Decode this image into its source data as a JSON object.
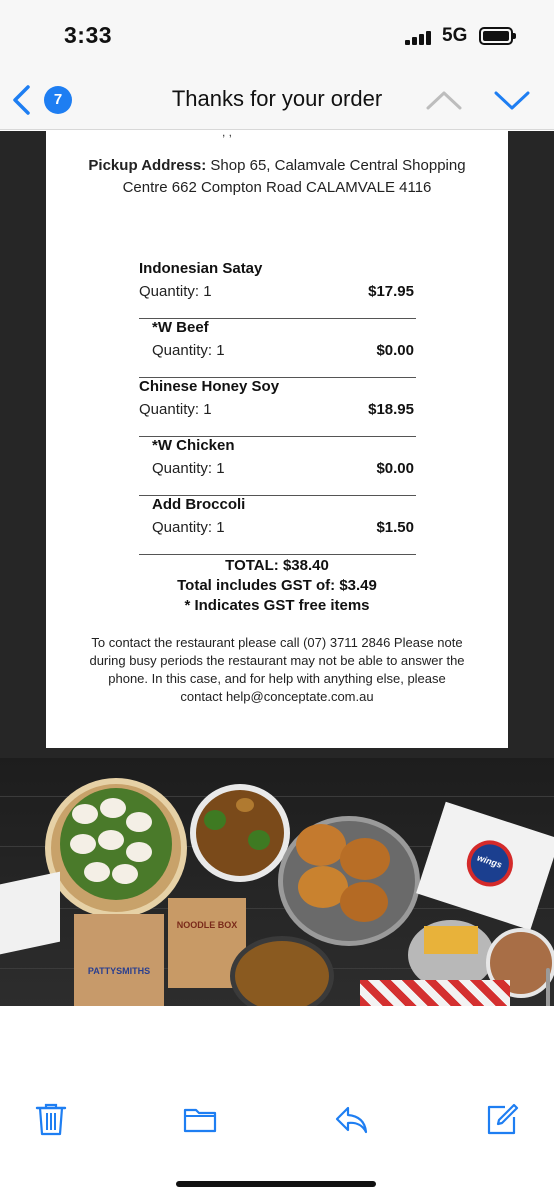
{
  "status": {
    "time": "3:33",
    "network": "5G"
  },
  "nav": {
    "badge_count": "7",
    "title": "Thanks for your order"
  },
  "order": {
    "cut_off_text": ", ,",
    "pickup_label": "Pickup Address:",
    "pickup_address": " Shop 65, Calamvale Central Shopping Centre 662 Compton Road CALAMVALE 4116",
    "items": [
      {
        "name": "Indonesian Satay",
        "quantity": "Quantity: 1",
        "price": "$17.95",
        "level": "top"
      },
      {
        "name": "*W Beef",
        "quantity": "Quantity: 1",
        "price": "$0.00",
        "level": "sub"
      },
      {
        "name": "Chinese Honey Soy",
        "quantity": "Quantity: 1",
        "price": "$18.95",
        "level": "top"
      },
      {
        "name": "*W Chicken",
        "quantity": "Quantity: 1",
        "price": "$0.00",
        "level": "sub"
      },
      {
        "name": "Add Broccoli",
        "quantity": "Quantity: 1",
        "price": "$1.50",
        "level": "sub"
      }
    ],
    "total": "TOTAL: $38.40",
    "gst": "Total includes GST of: $3.49",
    "gst_free_note": "* Indicates GST free items",
    "contact": "To contact the restaurant please call (07) 3711 2846 Please note during busy periods the restaurant may not be able to answer the phone. In this case, and for help with anything else, please contact help@conceptate.com.au"
  },
  "banner": {
    "noodle_box_label": "NOODLE BOX",
    "pattysmiths_label": "PATTYSMITHS",
    "wings_label": "wings"
  },
  "toolbar": {
    "icons": [
      "trash-icon",
      "folder-icon",
      "reply-icon",
      "compose-icon"
    ]
  },
  "colors": {
    "accent": "#1e7ef2",
    "badge": "#1e7ef2"
  }
}
